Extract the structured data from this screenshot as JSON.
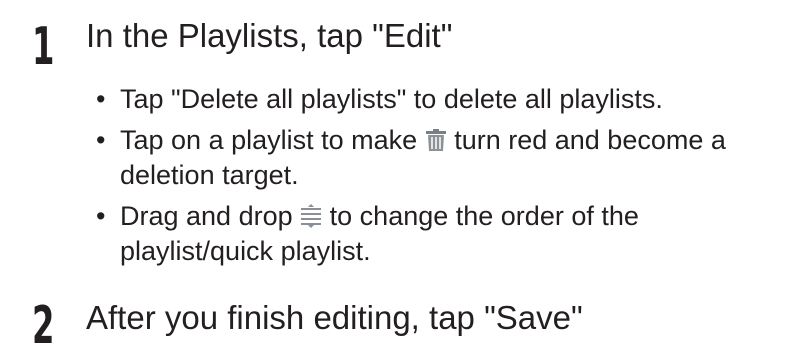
{
  "steps": [
    {
      "number": "1",
      "title": "In the Playlists, tap \"Edit\""
    },
    {
      "number": "2",
      "title": "After you finish editing, tap \"Save\""
    }
  ],
  "bullet_marker": "•",
  "bullets": [
    {
      "text": "Tap \"Delete all playlists\" to delete all playlists."
    },
    {
      "before": "Tap on a playlist to make",
      "after": "turn red and become a deletion target.",
      "icon": "trash-icon"
    },
    {
      "before": "Drag and drop",
      "after": "to change the order of the playlist/quick playlist.",
      "icon": "reorder-handle-icon"
    }
  ],
  "colors": {
    "text": "#231f20",
    "trash_icon": "#7a7f86",
    "handle_icon": "#8a8f96"
  }
}
